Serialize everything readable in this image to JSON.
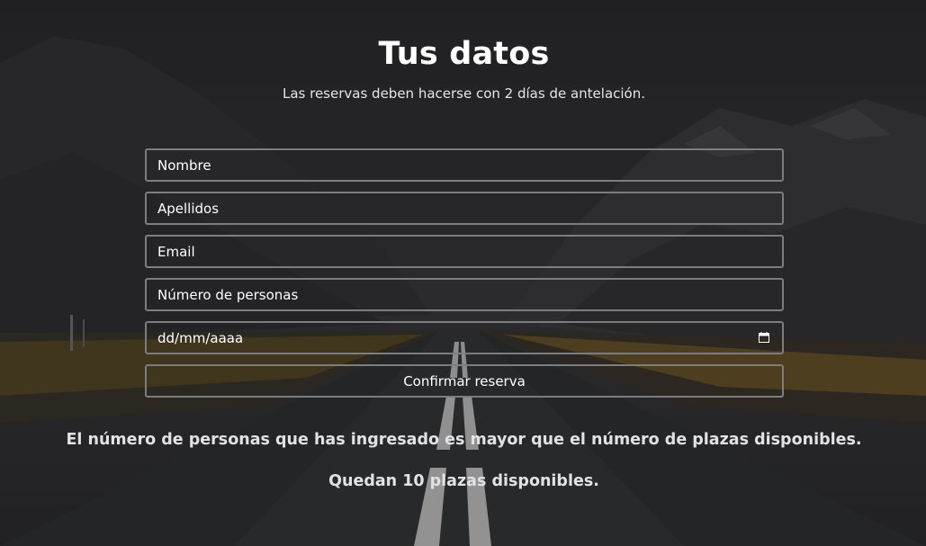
{
  "header": {
    "title": "Tus datos",
    "subtitle": "Las reservas deben hacerse con 2 días de antelación."
  },
  "form": {
    "name_placeholder": "Nombre",
    "lastname_placeholder": "Apellidos",
    "email_placeholder": "Email",
    "people_placeholder": "Número de personas",
    "date_placeholder": "dd/mm/aaaa",
    "submit_label": "Confirmar reserva"
  },
  "messages": {
    "error": "El número de personas que has ingresado es mayor que el número de plazas disponibles.",
    "availability": "Quedan 10 plazas disponibles."
  },
  "colors": {
    "text": "#ffffff",
    "border": "#7d7d80",
    "background": "#2b2b2d",
    "road_line": "#d8d8d8",
    "grass": "#8a6a2a"
  },
  "icons": {
    "date_field": "calendar-icon"
  }
}
